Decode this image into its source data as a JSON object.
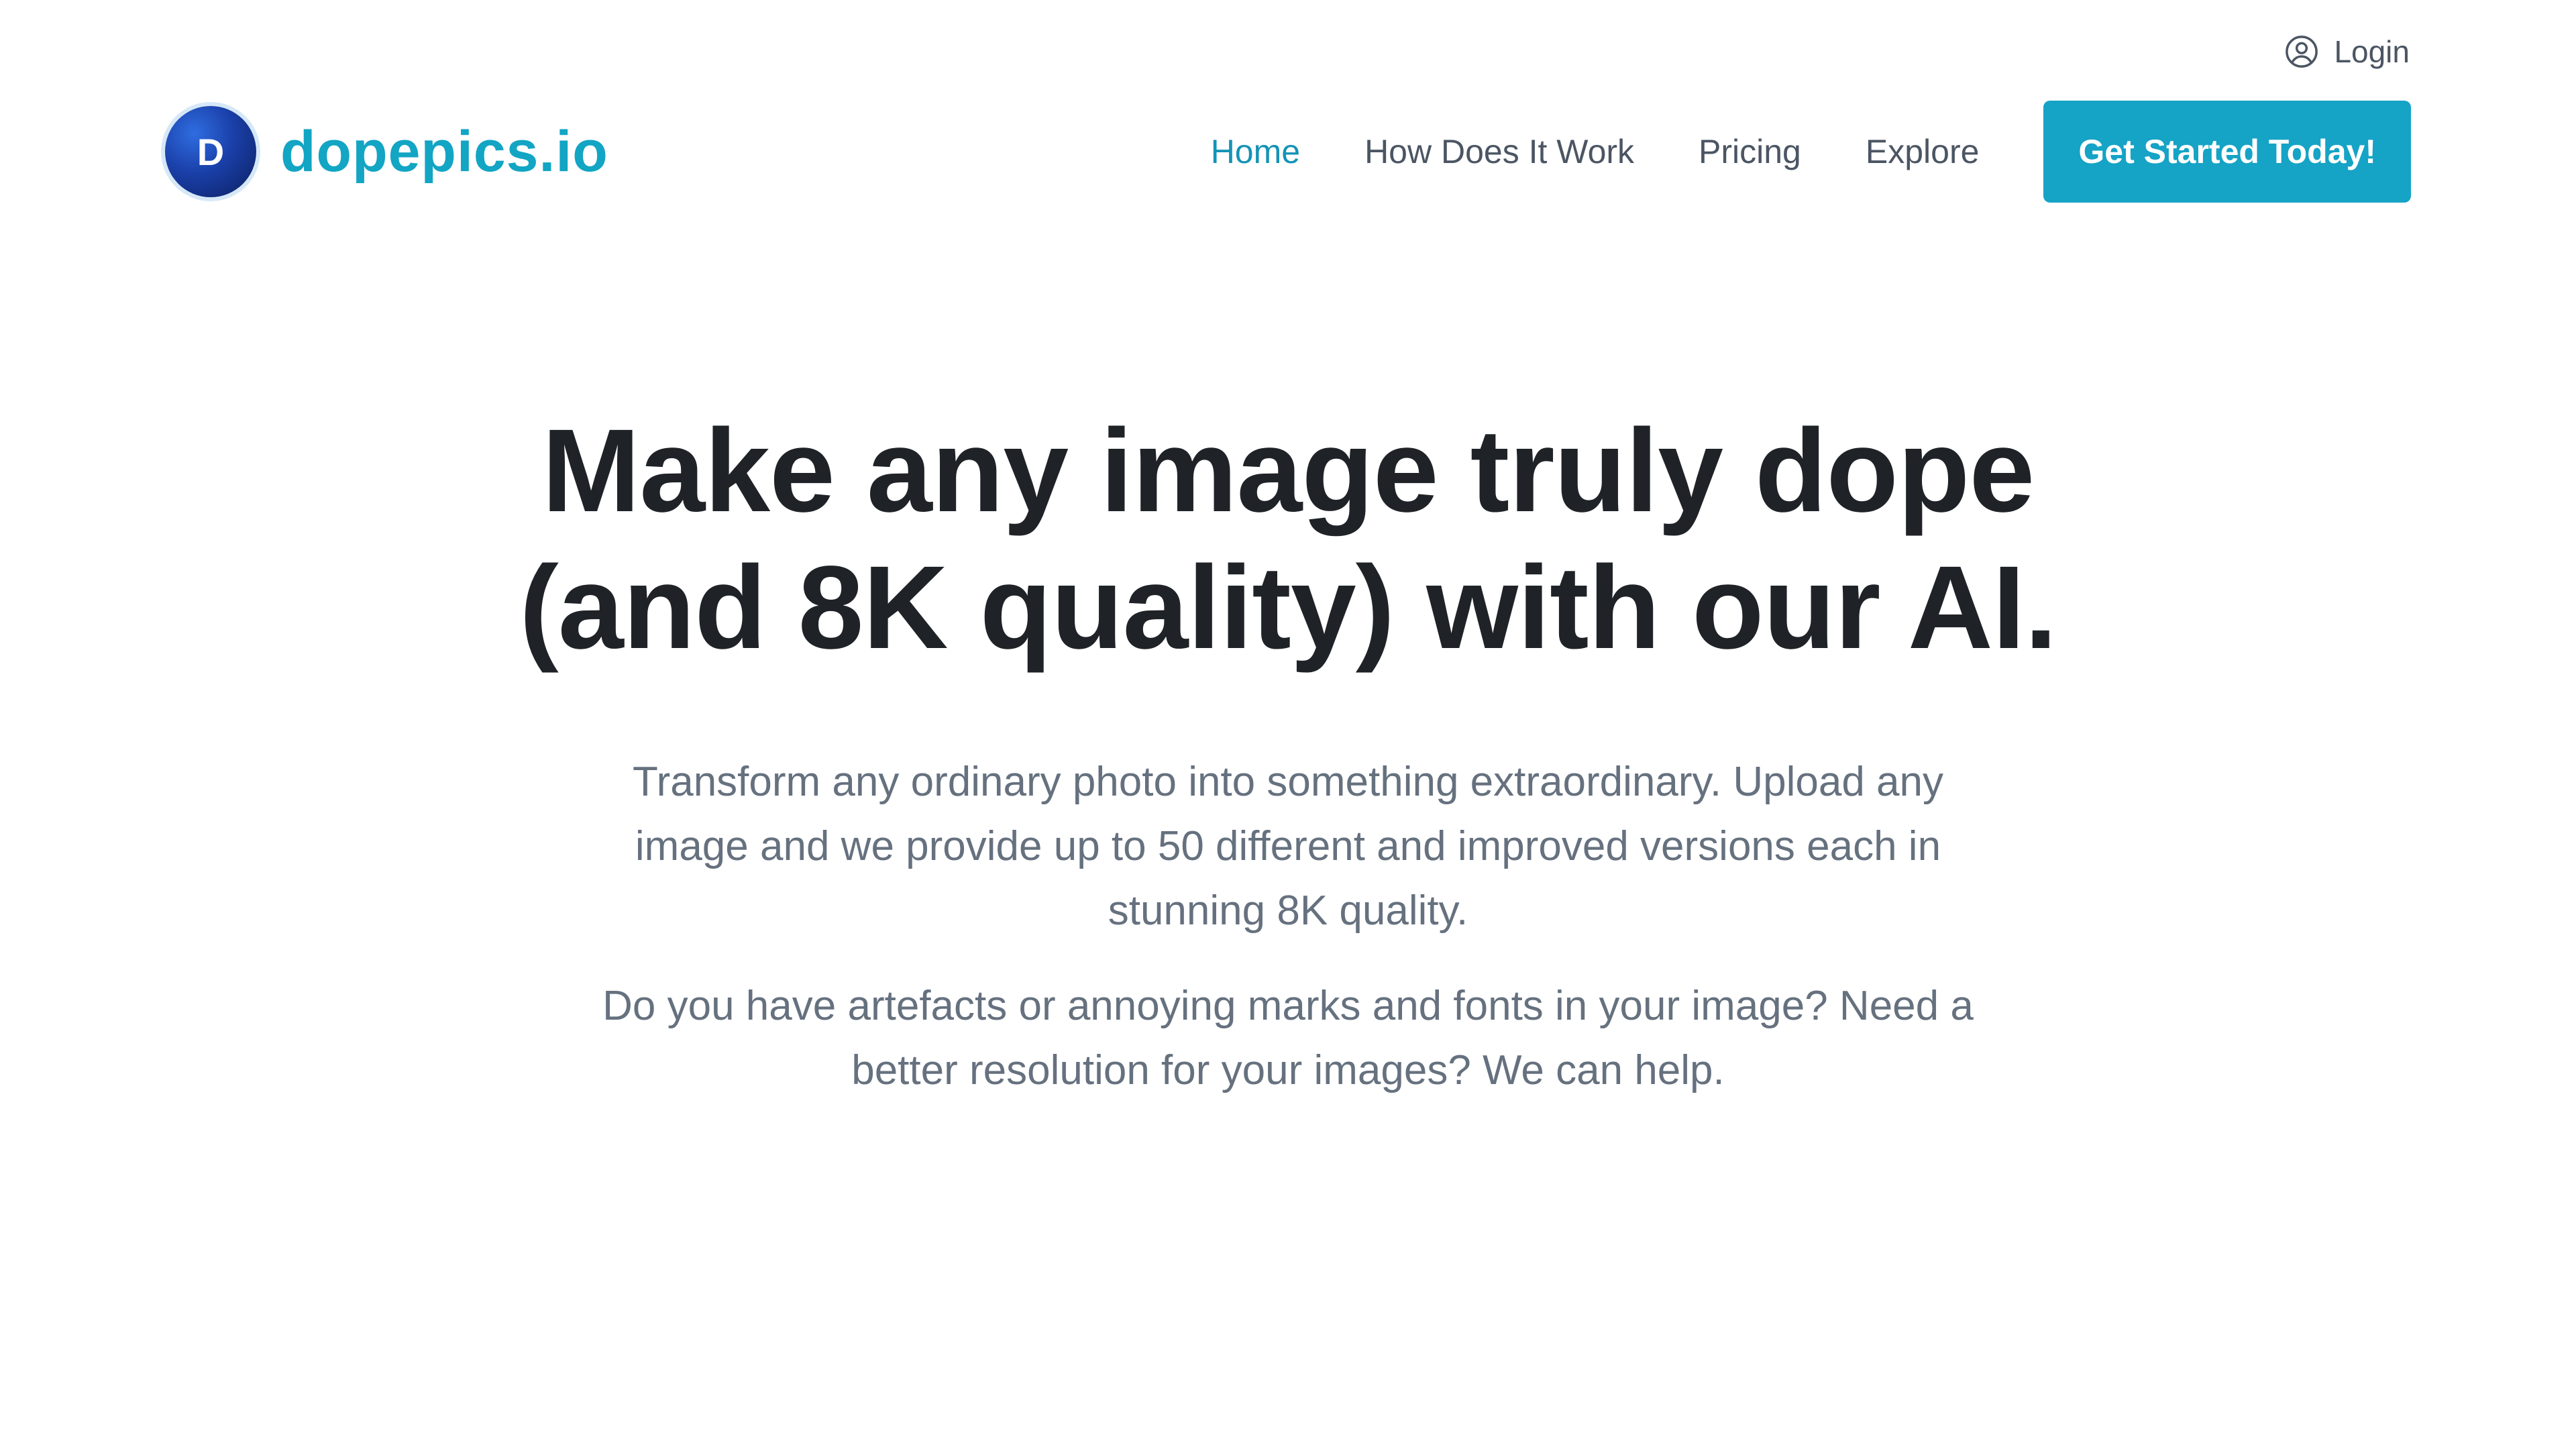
{
  "login": {
    "icon": "user-circle-icon",
    "label": "Login"
  },
  "brand": {
    "logo_letter": "D",
    "name": "dopepics.io",
    "color": "#12a5c4"
  },
  "nav": {
    "items": [
      {
        "label": "Home",
        "active": true
      },
      {
        "label": "How Does It Work",
        "active": false
      },
      {
        "label": "Pricing",
        "active": false
      },
      {
        "label": "Explore",
        "active": false
      }
    ],
    "cta_label": "Get Started Today!",
    "cta_color": "#15a3c6"
  },
  "hero": {
    "headline_line1": "Make any image truly dope",
    "headline_line2": "(and 8K quality) with our AI.",
    "paragraph1": "Transform any ordinary photo into something extraordinary. Upload any image and we provide up to 50 different and improved versions each in stunning 8K quality.",
    "paragraph2": "Do you have artefacts or annoying marks and fonts in your image? Need a better resolution for your images? We can help."
  }
}
